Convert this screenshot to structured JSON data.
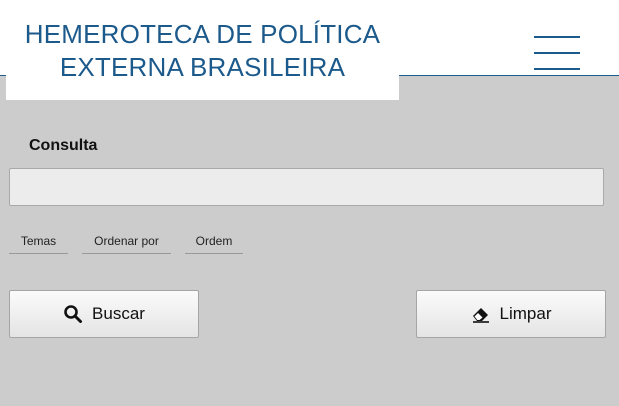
{
  "header": {
    "logo_line1": "HEMEROTECA DE POLÍTICA",
    "logo_line2": "EXTERNA BRASILEIRA",
    "menu_icon": "hamburger-menu-icon"
  },
  "form": {
    "consulta_label": "Consulta",
    "consulta_value": "",
    "filters": {
      "temas": "Temas",
      "ordenar_por": "Ordenar por",
      "ordem": "Ordem"
    },
    "buttons": {
      "buscar": "Buscar",
      "limpar": "Limpar"
    },
    "icons": {
      "buscar": "search-icon",
      "limpar": "eraser-icon"
    }
  },
  "colors": {
    "brand_blue": "#1d5a8c",
    "background": "#cccccc"
  }
}
